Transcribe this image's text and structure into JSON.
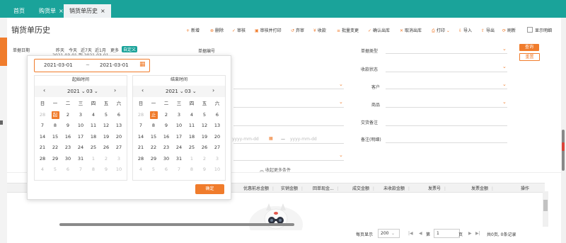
{
  "tabs": [
    {
      "label": "首页",
      "closable": false
    },
    {
      "label": "购货单",
      "closable": true
    },
    {
      "label": "销货单历史",
      "closable": true,
      "active": true
    }
  ],
  "page_title": "销货单历史",
  "toolbar": [
    {
      "icon": "plus-icon",
      "label": "新增"
    },
    {
      "icon": "delete-icon",
      "label": "删除"
    },
    {
      "icon": "check-icon",
      "label": "审核"
    },
    {
      "icon": "print-check-icon",
      "label": "审核并打印"
    },
    {
      "icon": "undo-icon",
      "label": "弃审"
    },
    {
      "icon": "collect-icon",
      "label": "收款"
    },
    {
      "icon": "batch-icon",
      "label": "批量变更"
    },
    {
      "icon": "confirm-icon",
      "label": "确认出库"
    },
    {
      "icon": "cancel-icon",
      "label": "取消出库"
    },
    {
      "icon": "printer-icon",
      "label": "打印"
    },
    {
      "icon": "import-icon",
      "label": "导入"
    },
    {
      "icon": "export-icon",
      "label": "导出"
    },
    {
      "icon": "refresh-icon",
      "label": "刷新"
    }
  ],
  "show_detail_label": "显示明细",
  "filters": {
    "date_label": "单据日期",
    "quick_dates": [
      "昨天",
      "今天",
      "近7天",
      "近1月",
      "更多",
      "自定义"
    ],
    "date_behind": "2021-03-01 到 2021-03-01",
    "bill_no_label": "单据编号",
    "bill_type_label": "单据类型",
    "collect_status_label": "收款状态",
    "customer_label": "客户",
    "product_label": "商品",
    "delivery_note_label": "交货备注",
    "remark_label": "备注(明细)",
    "date_placeholder": "yyyy-mm-dd",
    "date_separator": "—",
    "collapse_label": "收起更多条件"
  },
  "query_button": "查询",
  "reset_button": "重置",
  "date_picker": {
    "start_value": "2021-03-01",
    "end_value": "2021-03-01",
    "range_separator": "~",
    "start_title": "起始时间",
    "end_title": "结束时间",
    "year": "2021",
    "month": "03",
    "weekdays": [
      "日",
      "一",
      "二",
      "三",
      "四",
      "五",
      "六"
    ],
    "start_weeks": [
      [
        "28",
        "起",
        "2",
        "3",
        "4",
        "5",
        "6"
      ],
      [
        "7",
        "8",
        "9",
        "10",
        "11",
        "12",
        "13"
      ],
      [
        "14",
        "15",
        "16",
        "17",
        "18",
        "19",
        "20"
      ],
      [
        "21",
        "22",
        "23",
        "24",
        "25",
        "26",
        "27"
      ],
      [
        "28",
        "29",
        "30",
        "31",
        "1",
        "2",
        "3"
      ],
      [
        "4",
        "5",
        "6",
        "7",
        "8",
        "9",
        "10"
      ]
    ],
    "end_weeks": [
      [
        "28",
        "止",
        "2",
        "3",
        "4",
        "5",
        "6"
      ],
      [
        "7",
        "8",
        "9",
        "10",
        "11",
        "12",
        "13"
      ],
      [
        "14",
        "15",
        "16",
        "17",
        "18",
        "19",
        "20"
      ],
      [
        "21",
        "22",
        "23",
        "24",
        "25",
        "26",
        "27"
      ],
      [
        "28",
        "29",
        "30",
        "31",
        "1",
        "2",
        "3"
      ],
      [
        "4",
        "5",
        "6",
        "7",
        "8",
        "9",
        "10"
      ]
    ],
    "ok_label": "确定"
  },
  "table_headers": [
    "优惠前总金额",
    "实销金额",
    "回单现金...",
    "成交金额",
    "未收款金额",
    "发票号",
    "发票金额",
    "操作"
  ],
  "pagination": {
    "per_page_label": "每页显示",
    "per_page_value": "200",
    "page_prefix": "第",
    "page_value": "1",
    "page_suffix": "页",
    "total_label": "共0页, 0条记录"
  },
  "colors": {
    "primary": "#1aa39a",
    "accent": "#f07c2c"
  }
}
